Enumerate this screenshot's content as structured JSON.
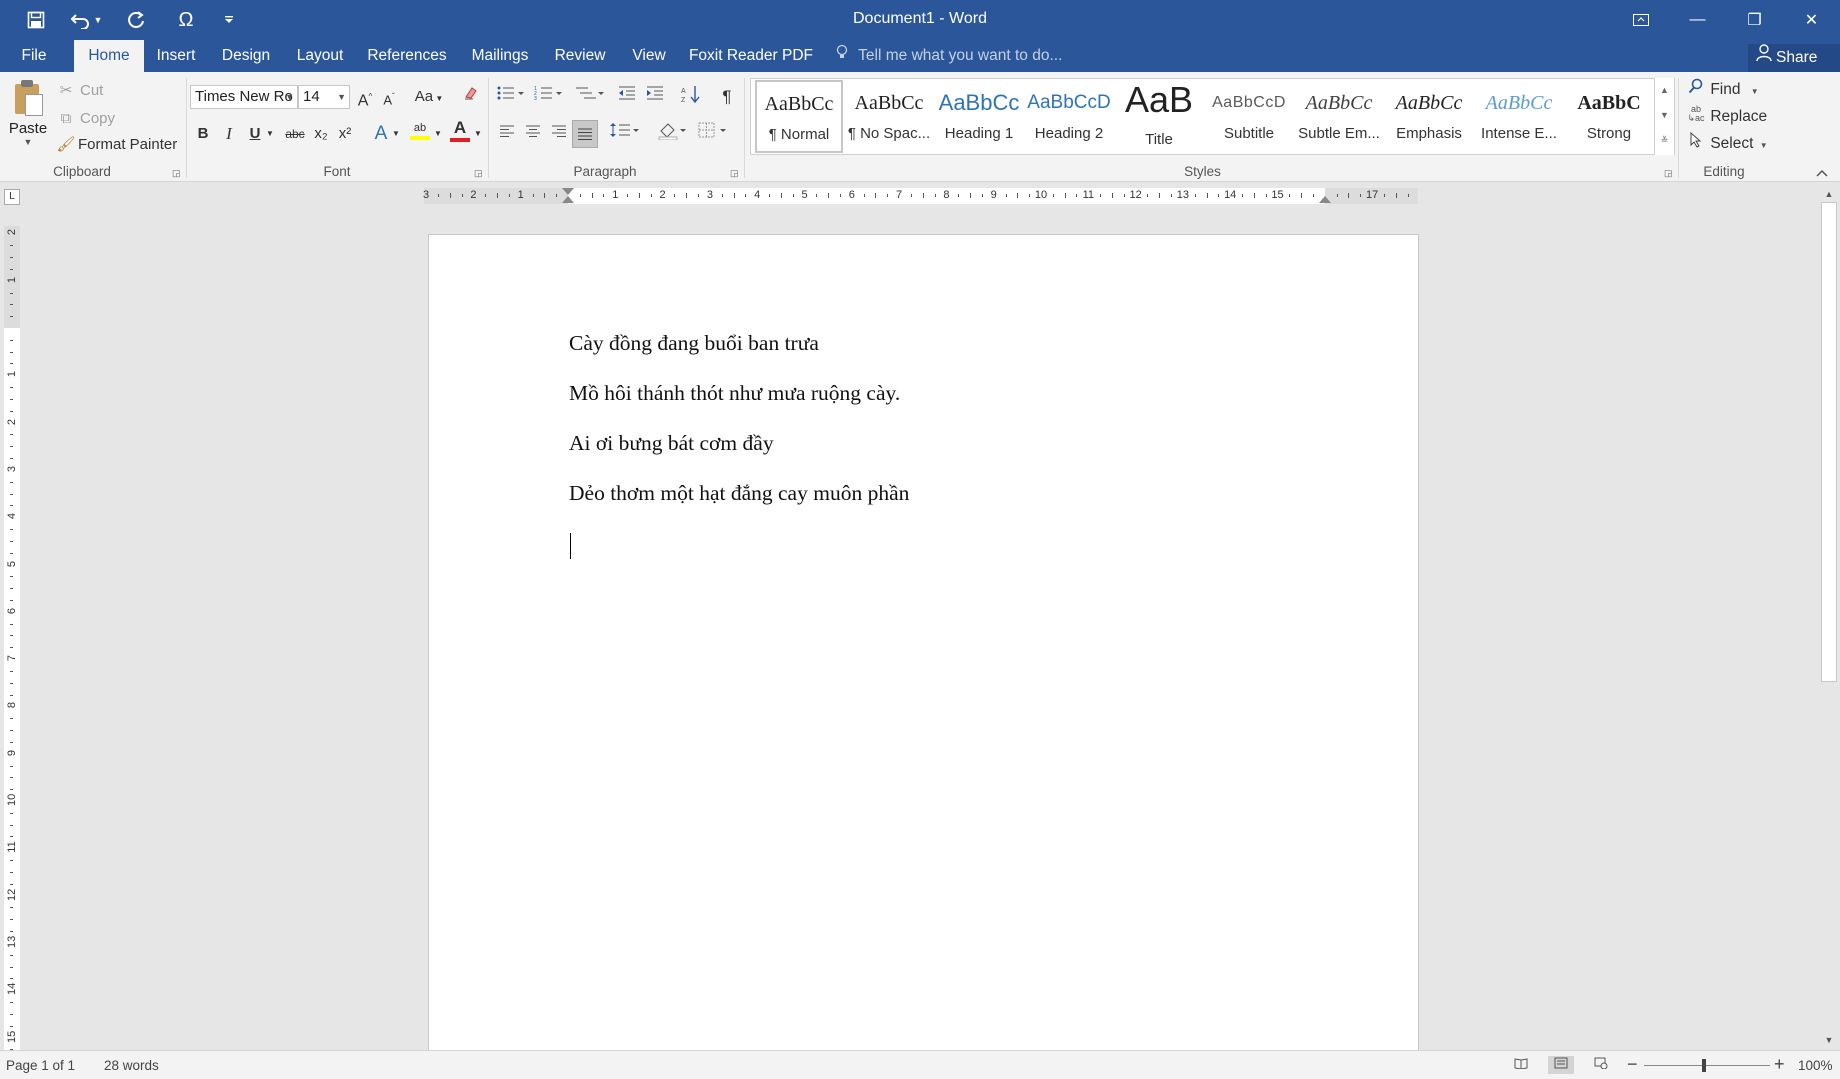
{
  "window": {
    "title": "Document1 - Word",
    "controls": {
      "ribbon_options": "⧉",
      "minimize": "—",
      "restore": "❐",
      "close": "✕"
    }
  },
  "quick_access": {
    "save_icon": "save-icon",
    "undo_icon": "undo-icon",
    "redo_icon": "redo-icon",
    "symbol_label": "Ω",
    "customize_icon": "customize-icon"
  },
  "tabs": [
    {
      "label": "File",
      "active": false
    },
    {
      "label": "Home",
      "active": true
    },
    {
      "label": "Insert",
      "active": false
    },
    {
      "label": "Design",
      "active": false
    },
    {
      "label": "Layout",
      "active": false
    },
    {
      "label": "References",
      "active": false
    },
    {
      "label": "Mailings",
      "active": false
    },
    {
      "label": "Review",
      "active": false
    },
    {
      "label": "View",
      "active": false
    },
    {
      "label": "Foxit Reader PDF",
      "active": false
    }
  ],
  "tell_me": {
    "placeholder": "Tell me what you want to do..."
  },
  "share": {
    "label": "Share"
  },
  "clipboard": {
    "group_label": "Clipboard",
    "paste_label": "Paste",
    "cut_label": "Cut",
    "copy_label": "Copy",
    "format_painter_label": "Format Painter"
  },
  "font": {
    "group_label": "Font",
    "font_name": "Times New Ro",
    "font_size": "14",
    "grow_label": "A",
    "shrink_label": "A",
    "case_label": "Aa",
    "bold_label": "B",
    "italic_label": "I",
    "underline_label": "U",
    "strikethrough_label": "abc",
    "subscript_label": "x₂",
    "superscript_label": "x²",
    "text_effects_label": "A",
    "highlight_label": "ab",
    "font_color_label": "A",
    "font_color": "#e02020",
    "highlight_color": "#ffff00"
  },
  "paragraph": {
    "group_label": "Paragraph",
    "show_marks_label": "¶"
  },
  "styles": {
    "group_label": "Styles",
    "items": [
      {
        "sample": "AaBbCc",
        "name": "¶ Normal"
      },
      {
        "sample": "AaBbCc",
        "name": "¶ No Spac..."
      },
      {
        "sample": "AaBbCc",
        "name": "Heading 1"
      },
      {
        "sample": "AaBbCcD",
        "name": "Heading 2"
      },
      {
        "sample": "AaB",
        "name": "Title"
      },
      {
        "sample": "AaBbCcD",
        "name": "Subtitle"
      },
      {
        "sample": "AaBbCc",
        "name": "Subtle Em..."
      },
      {
        "sample": "AaBbCc",
        "name": "Emphasis"
      },
      {
        "sample": "AaBbCc",
        "name": "Intense E..."
      },
      {
        "sample": "AaBbC",
        "name": "Strong"
      }
    ]
  },
  "editing": {
    "group_label": "Editing",
    "find_label": "Find",
    "replace_label": "Replace",
    "select_label": "Select"
  },
  "ruler": {
    "corner_label": "L",
    "h_numbers": [
      "3",
      "2",
      "1",
      "1",
      "2",
      "3",
      "4",
      "5",
      "6",
      "7",
      "8",
      "9",
      "10",
      "11",
      "12",
      "13",
      "14",
      "15",
      "17"
    ],
    "v_numbers": [
      "2",
      "1",
      "1",
      "2",
      "3",
      "4",
      "5",
      "6",
      "7",
      "8",
      "9",
      "10",
      "11",
      "12",
      "13",
      "14",
      "15"
    ]
  },
  "document": {
    "lines": [
      "Cày đồng đang buổi ban trưa",
      "Mồ hôi thánh thót như mưa ruộng cày.",
      "Ai ơi bưng bát cơm đầy",
      "Dẻo thơm một hạt đắng cay muôn phần"
    ]
  },
  "status": {
    "page": "Page 1 of 1",
    "words": "28 words",
    "zoom": "100%",
    "zoom_out": "−",
    "zoom_in": "+"
  },
  "colors": {
    "accent": "#2b579a",
    "ribbon_bg": "#f3f3f3",
    "heading_blue": "#2e74b5"
  }
}
